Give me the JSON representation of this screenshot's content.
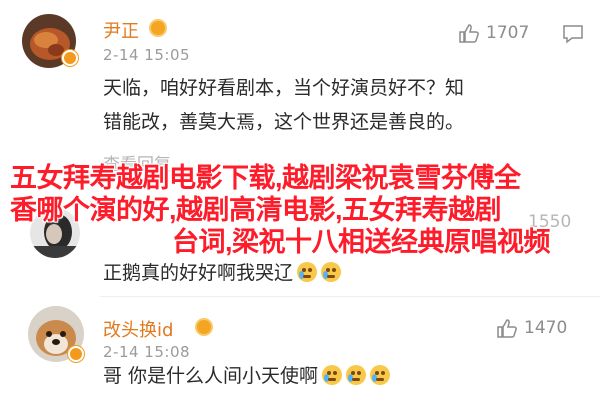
{
  "comments": [
    {
      "username": "尹正",
      "time": "2-14 15:05",
      "likes": "1707",
      "text_lines": [
        "天临，咱好好看剧本，当个好演员好不？知",
        "错能改，善莫大焉，这个世界还是善良的。"
      ]
    },
    {
      "username": "查看回复",
      "time": "",
      "likes": "",
      "text_lines": [
        "正鹅真的好好啊我哭辽"
      ]
    },
    {
      "username": "改头换id",
      "time": "2-14 15:08",
      "likes": "1470",
      "text_lines": [
        "哥 你是什么人间小天使啊"
      ]
    }
  ],
  "faded": {
    "partial_text": "查看回复",
    "partial_count": "1550"
  },
  "overlay": {
    "line1": "五女拜寿越剧电影下载,越剧梁祝袁雪芬傅全",
    "line2": "香哪个演的好,越剧高清电影,五女拜寿越剧",
    "line3": "台词,梁祝十八相送经典原唱视频"
  },
  "colors": {
    "username": "#e07a1f",
    "overlay": "#ff1c2a",
    "time": "#9b9b9b"
  },
  "icons": {
    "like": "thumbs-up-icon",
    "reply": "comment-icon",
    "vip": "vip-badge-icon",
    "emoji": "crying-emoji-icon"
  }
}
